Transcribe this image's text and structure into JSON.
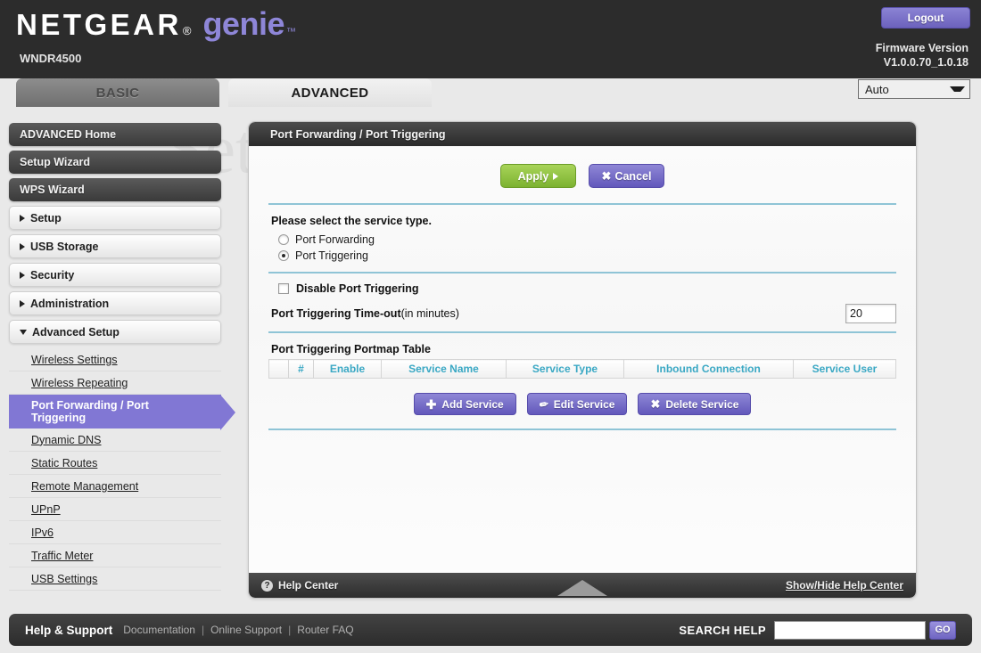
{
  "header": {
    "brand_netgear": "NETGEAR",
    "brand_reg": "®",
    "brand_genie": "genie",
    "brand_tm": "™",
    "model": "WNDR4500",
    "logout_label": "Logout",
    "firmware_label": "Firmware Version",
    "firmware_value": "V1.0.0.70_1.0.18",
    "language_selected": "Auto"
  },
  "tabs": [
    {
      "label": "BASIC",
      "active": false
    },
    {
      "label": "ADVANCED",
      "active": true
    }
  ],
  "watermark": "SetupRouter.com",
  "sidebar": {
    "primary": [
      {
        "label": "ADVANCED Home",
        "style": "dark"
      },
      {
        "label": "Setup Wizard",
        "style": "dark"
      },
      {
        "label": "WPS Wizard",
        "style": "dark"
      },
      {
        "label": "Setup",
        "style": "light",
        "arrow": "right"
      },
      {
        "label": "USB Storage",
        "style": "light",
        "arrow": "right"
      },
      {
        "label": "Security",
        "style": "light",
        "arrow": "right"
      },
      {
        "label": "Administration",
        "style": "light",
        "arrow": "right"
      },
      {
        "label": "Advanced Setup",
        "style": "light",
        "arrow": "down"
      }
    ],
    "submenu": [
      {
        "label": "Wireless Settings",
        "selected": false
      },
      {
        "label": "Wireless Repeating",
        "selected": false
      },
      {
        "label": "Port Forwarding / Port Triggering",
        "selected": true
      },
      {
        "label": "Dynamic DNS",
        "selected": false
      },
      {
        "label": "Static Routes",
        "selected": false
      },
      {
        "label": "Remote Management",
        "selected": false
      },
      {
        "label": "UPnP",
        "selected": false
      },
      {
        "label": "IPv6",
        "selected": false
      },
      {
        "label": "Traffic Meter",
        "selected": false
      },
      {
        "label": "USB Settings",
        "selected": false
      }
    ]
  },
  "panel": {
    "title": "Port Forwarding / Port Triggering",
    "apply_label": "Apply",
    "cancel_label": "Cancel",
    "service_type_label": "Please select the service type.",
    "radios": [
      {
        "label": "Port Forwarding",
        "selected": false
      },
      {
        "label": "Port Triggering",
        "selected": true
      }
    ],
    "disable_checkbox_label": "Disable Port Triggering",
    "disable_checkbox_checked": false,
    "timeout_label_bold": "Port Triggering Time-out",
    "timeout_label_normal": "(in minutes)",
    "timeout_value": "20",
    "table_title": "Port Triggering Portmap Table",
    "table_headers": [
      "",
      "#",
      "Enable",
      "Service Name",
      "Service Type",
      "Inbound Connection",
      "Service User"
    ],
    "table_rows": [],
    "service_buttons": [
      {
        "label": "Add Service",
        "icon": "plus-icon"
      },
      {
        "label": "Edit Service",
        "icon": "pencil-icon"
      },
      {
        "label": "Delete Service",
        "icon": "x-icon"
      }
    ],
    "footer": {
      "help_center_label": "Help Center",
      "help_icon": "question-circle-icon",
      "show_hide_label": "Show/Hide Help Center"
    }
  },
  "helpbar": {
    "title": "Help & Support",
    "links": [
      "Documentation",
      "Online Support",
      "Router FAQ"
    ],
    "search_label": "SEARCH HELP",
    "search_value": "",
    "search_placeholder": "",
    "go_label": "GO"
  }
}
